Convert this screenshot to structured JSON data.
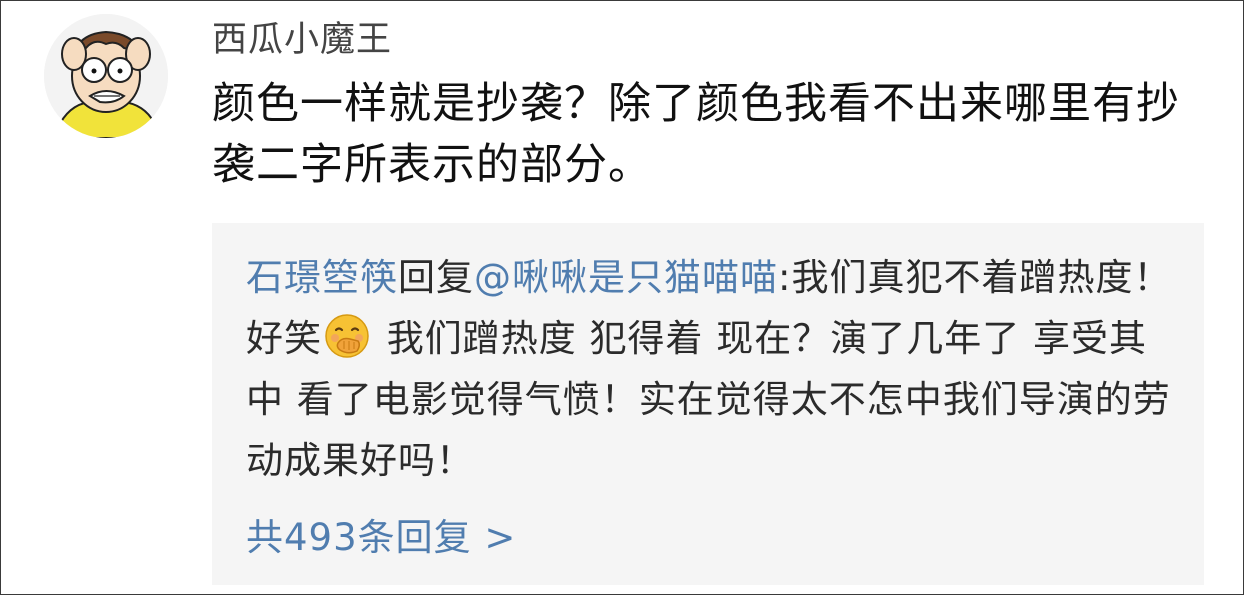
{
  "post": {
    "username": "西瓜小魔王",
    "comment": "颜色一样就是抄袭？除了颜色我看不出来哪里有抄袭二字所表示的部分。"
  },
  "reply": {
    "author": "石璟箜筷",
    "action": "回复",
    "mention": "@啾啾是只猫喵喵",
    "text_before_emoji": ":我们真犯不着蹭热度！好笑",
    "emoji": "hand-over-mouth-emoji",
    "text_after_emoji": " 我们蹭热度 犯得着 现在？演了几年了 享受其中 看了电影觉得气愤！实在觉得太不怎中我们导演的劳动成果好吗！"
  },
  "reply_count_label": "共493条回复 >",
  "colors": {
    "link": "#507daf",
    "reply_bg": "#f5f5f5",
    "text": "#111111"
  },
  "icons": {
    "avatar": "cartoon-avatar-icon"
  }
}
